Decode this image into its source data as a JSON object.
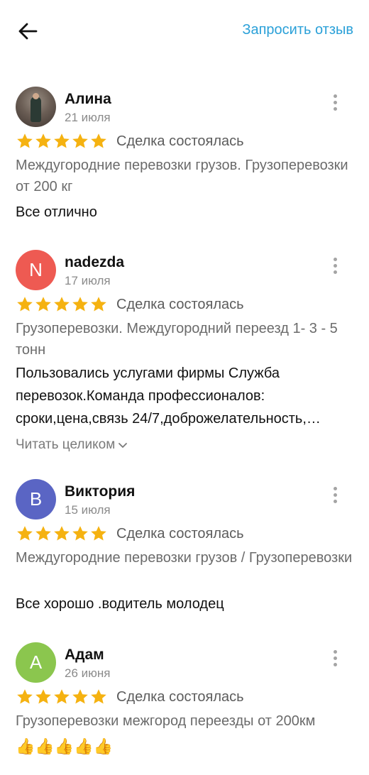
{
  "header": {
    "back_icon": "arrow-left-icon",
    "request_review_label": "Запросить отзыв",
    "link_color": "#2aa0d8"
  },
  "colors": {
    "star": "#f5b211",
    "avatar_n": "#ee5a52",
    "avatar_b": "#5a65c4",
    "avatar_a": "#8bc64e"
  },
  "reviews": [
    {
      "name": "Алина",
      "date": "21 июля",
      "avatar_letter": "",
      "stars": 5,
      "status": "Сделка состоялась",
      "service": "Междугородние перевозки грузов. Грузоперевозки от 200 кг",
      "text": "Все отлично"
    },
    {
      "name": "nadezda",
      "date": "17 июля",
      "avatar_letter": "N",
      "stars": 5,
      "status": "Сделка состоялась",
      "service": "Грузоперевозки. Междугородний переезд 1- 3 - 5 тонн",
      "text": "Пользовались услугами фирмы Служба перевозок.Команда профессионалов: сроки,цена,связь 24/7,доброжелательность,…",
      "read_more": "Читать целиком"
    },
    {
      "name": "Виктория",
      "date": "15 июля",
      "avatar_letter": "В",
      "stars": 5,
      "status": "Сделка состоялась",
      "service": "Междугородние перевозки грузов / Грузоперевозки",
      "text": "Все хорошо .водитель молодец"
    },
    {
      "name": "Адам",
      "date": "26 июня",
      "avatar_letter": "А",
      "stars": 5,
      "status": "Сделка состоялась",
      "service": "Грузоперевозки межгород переезды от 200км",
      "text": "👍👍👍👍👍"
    }
  ]
}
